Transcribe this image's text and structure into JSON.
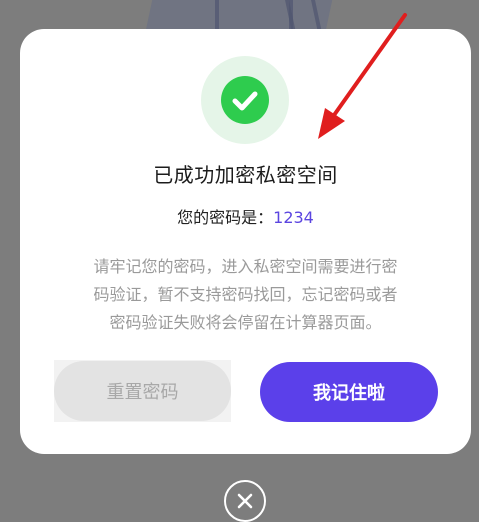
{
  "dialog": {
    "title": "已成功加密私密空间",
    "password_label": "您的密码是：",
    "password_value": "1234",
    "notice_line1": "请牢记您的密码，进入私密空间需要进行密",
    "notice_line2": "码验证，暂不支持密码找回，忘记密码或者",
    "notice_line3": "密码验证失败将会停留在计算器页面。",
    "reset_button_label": "重置密码",
    "confirm_button_label": "我记住啦"
  },
  "icons": {
    "success": "check-icon",
    "close": "close-icon",
    "annotation": "arrow-icon"
  },
  "colors": {
    "accent": "#5b40ea",
    "success": "#2ecc4e",
    "annotation": "#e01e1e"
  }
}
